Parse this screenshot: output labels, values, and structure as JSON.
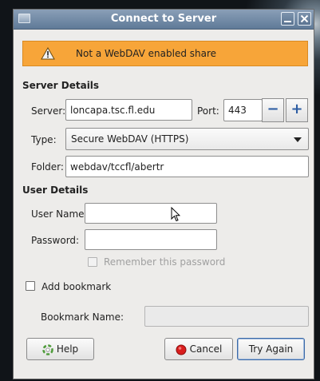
{
  "window": {
    "title": "Connect to Server",
    "icon": "folder-icon",
    "controls": [
      "minimize-icon",
      "close-icon"
    ]
  },
  "warning": {
    "icon": "warning-icon",
    "message": "Not a WebDAV enabled share",
    "color": "#f7a539"
  },
  "server_details": {
    "heading": "Server Details",
    "server_label": "Server:",
    "server_value": "loncapa.tsc.fl.edu",
    "port_label": "Port:",
    "port_value": "443",
    "port_decrement": "−",
    "port_increment": "+",
    "type_label": "Type:",
    "type_value": "Secure WebDAV (HTTPS)",
    "folder_label": "Folder:",
    "folder_value": "webdav/tccfl/abertr"
  },
  "user_details": {
    "heading": "User Details",
    "username_label": "User Name:",
    "username_value": "",
    "password_label": "Password:",
    "password_value": "",
    "remember_label": "Remember this password",
    "remember_checked": false
  },
  "bookmark": {
    "add_label": "Add bookmark",
    "add_checked": false,
    "name_label": "Bookmark Name:",
    "name_value": ""
  },
  "buttons": {
    "help": "Help",
    "cancel": "Cancel",
    "try_again": "Try Again"
  }
}
